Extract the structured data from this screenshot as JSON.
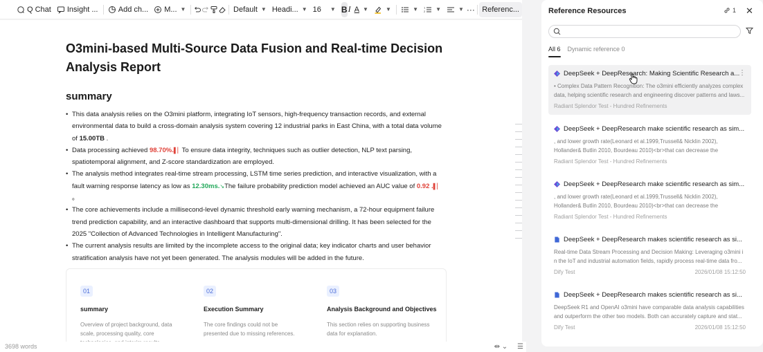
{
  "toolbar": {
    "q_chat": "Q Chat",
    "insight": "Insight ...",
    "add_chart": "Add ch...",
    "more_m": "M...",
    "font": "Default",
    "heading": "Headi...",
    "size": "16",
    "reference": "Referenc..."
  },
  "doc": {
    "title": "O3mini-based Multi-Source Data Fusion and Real-time Decision Analysis Report",
    "section": "summary",
    "b1_pre": "This data analysis relies on the O3mini platform, integrating IoT sensors, high-frequency transaction records, and external environmental data to build a cross-domain analysis system covering 12 industrial parks in East China, with a total data volume of ",
    "b1_val": "15.00TB",
    "b1_post": " .",
    "b2_pre": "Data processing achieved ",
    "b2_val": "98.70%.",
    "b2_post": "To ensure data integrity, techniques such as outlier detection, NLP text parsing, spatiotemporal alignment, and Z-score standardization are employed.",
    "b3_pre": "The analysis method integrates real-time stream processing, LSTM time series prediction, and interactive visualization, with a fault warning response latency as low as ",
    "b3_val": "12.30ms.",
    "b3_mid": "The failure probability prediction model achieved an AUC value of ",
    "b3_val2": "0.92 .",
    "b3_post": "。",
    "b4": "The core achievements include a millisecond-level dynamic threshold early warning mechanism, a 72-hour equipment failure trend prediction capability, and an interactive dashboard that supports multi-dimensional drilling. It has been selected for the 2025 \"Collection of Advanced Technologies in Intelligent Manufacturing\".",
    "b5": "The current analysis results are limited by the incomplete access to the original data; key indicator charts and user behavior stratification analysis have not yet been generated. The analysis modules will be added in the future."
  },
  "cards": [
    {
      "num": "01",
      "title": "summary",
      "desc": "Overview of project background, data scale, processing quality, core technologies, and interim results."
    },
    {
      "num": "02",
      "title": "Execution Summary",
      "desc": "The core findings could not be presented due to missing references."
    },
    {
      "num": "03",
      "title": "Analysis Background and Objectives",
      "desc": "This section relies on supporting business data for explanation."
    }
  ],
  "footer": {
    "words": "3698 words"
  },
  "panel": {
    "title": "Reference Resources",
    "count": "1",
    "tab_all": "All 6",
    "tab_dynamic": "Dynamic reference 0",
    "refs": [
      {
        "title": "DeepSeek + DeepResearch: Making Scientific Research a...",
        "snippet": "• Complex Data Pattern Recognition: The o3mini efficiently analyzes complex data, helping scientific research and engineering discover patterns and laws...",
        "source": "Radiant Splendor Test - Hundred Refinements",
        "date": ""
      },
      {
        "title": "DeepSeek + DeepResearch make scientific research as sim...",
        "snippet": ", and lower growth rate(Leonard et al.1999,Trussell& Nicklin 2002), Hollander& Butlin 2010, Bourdeau 2010)<br>that can decrease the susceptibility to pre...",
        "source": "Radiant Splendor Test - Hundred Refinements",
        "date": ""
      },
      {
        "title": "DeepSeek + DeepResearch make scientific research as sim...",
        "snippet": ", and lower growth rate(Leonard et al.1999,Trussell& Nicklin 2002), Hollander& Butlin 2010, Bourdeau 2010)<br>that can decrease the susceptibility to pre...",
        "source": "Radiant Splendor Test - Hundred Refinements",
        "date": ""
      },
      {
        "title": "DeepSeek + DeepResearch makes scientific research as si...",
        "snippet": "Real-time Data Stream Processing and Decision Making: Leveraging o3mini i n the IoT and industrial automation fields, rapidly process real-time data fro...",
        "source": "Dify Test",
        "date": "2026/01/08 15:12:50"
      },
      {
        "title": "DeepSeek + DeepResearch makes scientific research as si...",
        "snippet": "DeepSeek R1 and OpenAI o3mini have comparable data analysis capabilities and outperform the other two models. Both can accurately capture and stat...",
        "source": "Dify Test",
        "date": "2026/01/08 15:12:50"
      }
    ]
  }
}
